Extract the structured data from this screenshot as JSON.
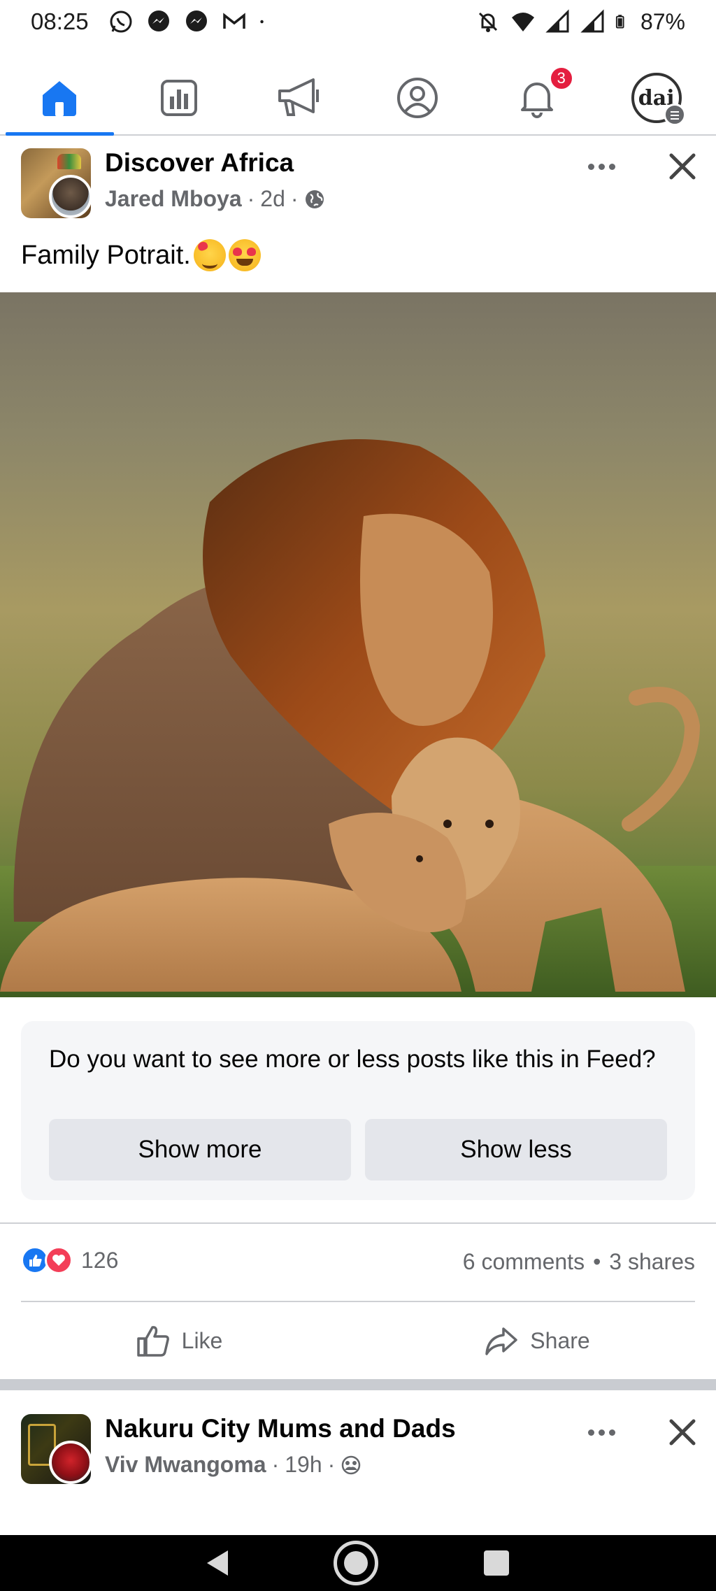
{
  "status_bar": {
    "time": "08:25",
    "left_icons": [
      "whatsapp-icon",
      "messenger-icon",
      "messenger-icon",
      "gmail-icon",
      "dot-icon"
    ],
    "right_icons": [
      "mute-icon",
      "wifi-icon",
      "signal-icon",
      "signal-icon",
      "battery-icon"
    ],
    "battery": "87%"
  },
  "top_nav": {
    "tabs": [
      {
        "name": "home",
        "icon": "home-icon",
        "active": true
      },
      {
        "name": "insights",
        "icon": "chart-icon",
        "active": false
      },
      {
        "name": "ads",
        "icon": "megaphone-icon",
        "active": false
      },
      {
        "name": "profile",
        "icon": "user-circle-icon",
        "active": false
      },
      {
        "name": "notifications",
        "icon": "bell-icon",
        "active": false,
        "badge": "3"
      },
      {
        "name": "menu",
        "icon": "profile-avatar",
        "active": false,
        "avatar_text": "dai"
      }
    ],
    "accent": "#1877f2",
    "badge_color": "#e41e3f"
  },
  "post1": {
    "group": "Discover Africa",
    "author": "Jared Mboya",
    "time": "2d",
    "sep": "·",
    "privacy_icon": "globe-icon",
    "caption": "Family Potrait.",
    "caption_emojis": [
      "smiling-face-with-hearts",
      "heart-eyes"
    ],
    "photo_subject": "lion-family-photo",
    "feedback": {
      "question": "Do you want to see more or less posts like this in Feed?",
      "show_more": "Show more",
      "show_less": "Show less"
    },
    "reaction_count": "126",
    "comments": "6 comments",
    "dot": "•",
    "shares": "3 shares",
    "actions": {
      "like": "Like",
      "share": "Share"
    }
  },
  "post2": {
    "group": "Nakuru City Mums and Dads",
    "author": "Viv Mwangoma",
    "time": "19h",
    "sep": "·",
    "privacy_icon": "group-members-icon"
  },
  "colors": {
    "like_blue": "#1877f2",
    "love_red": "#f33e58",
    "secondary_text": "#65676b"
  }
}
